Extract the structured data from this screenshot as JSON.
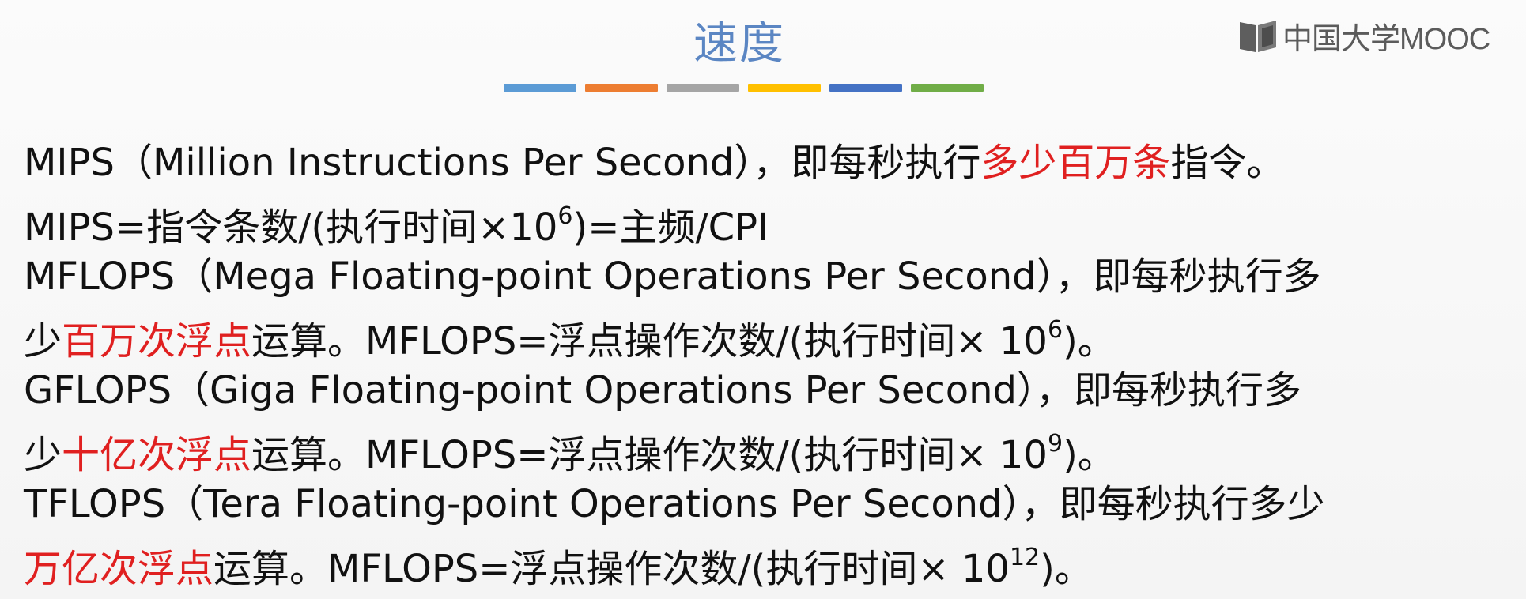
{
  "slide": {
    "title": "速度",
    "logo_text": "中国大学MOOC",
    "bar_colors": [
      "#5b9bd5",
      "#ed7d31",
      "#a5a5a5",
      "#ffc000",
      "#4472c4",
      "#70ad47"
    ],
    "accent_color": "#e02020",
    "title_color": "#5b86c3"
  },
  "lines": [
    {
      "prefix": "MIPS（Million Instructions Per Second），即每秒执行",
      "highlight": "多少百万条",
      "suffix": "指令。"
    },
    {
      "text": "MIPS=指令条数/(执行时间×10",
      "exp": "6",
      "tail": ")=主频/CPI"
    },
    {
      "text": "MFLOPS（Mega Floating-point Operations Per Second），即每秒执行多"
    },
    {
      "prefix": "少",
      "highlight": "百万次浮点",
      "suffix": "运算。MFLOPS=浮点操作次数/(执行时间× 10",
      "exp": "6",
      "tail": ")。"
    },
    {
      "text": "GFLOPS（Giga Floating-point Operations Per Second），即每秒执行多"
    },
    {
      "prefix": "少",
      "highlight": "十亿次浮点",
      "suffix": "运算。MFLOPS=浮点操作次数/(执行时间× 10",
      "exp": "9",
      "tail": ")。"
    },
    {
      "text": "TFLOPS（Tera Floating-point Operations Per Second），即每秒执行多少"
    },
    {
      "highlight": "万亿次浮点",
      "suffix": "运算。MFLOPS=浮点操作次数/(执行时间× 10",
      "exp": "12",
      "tail": ")。"
    }
  ]
}
